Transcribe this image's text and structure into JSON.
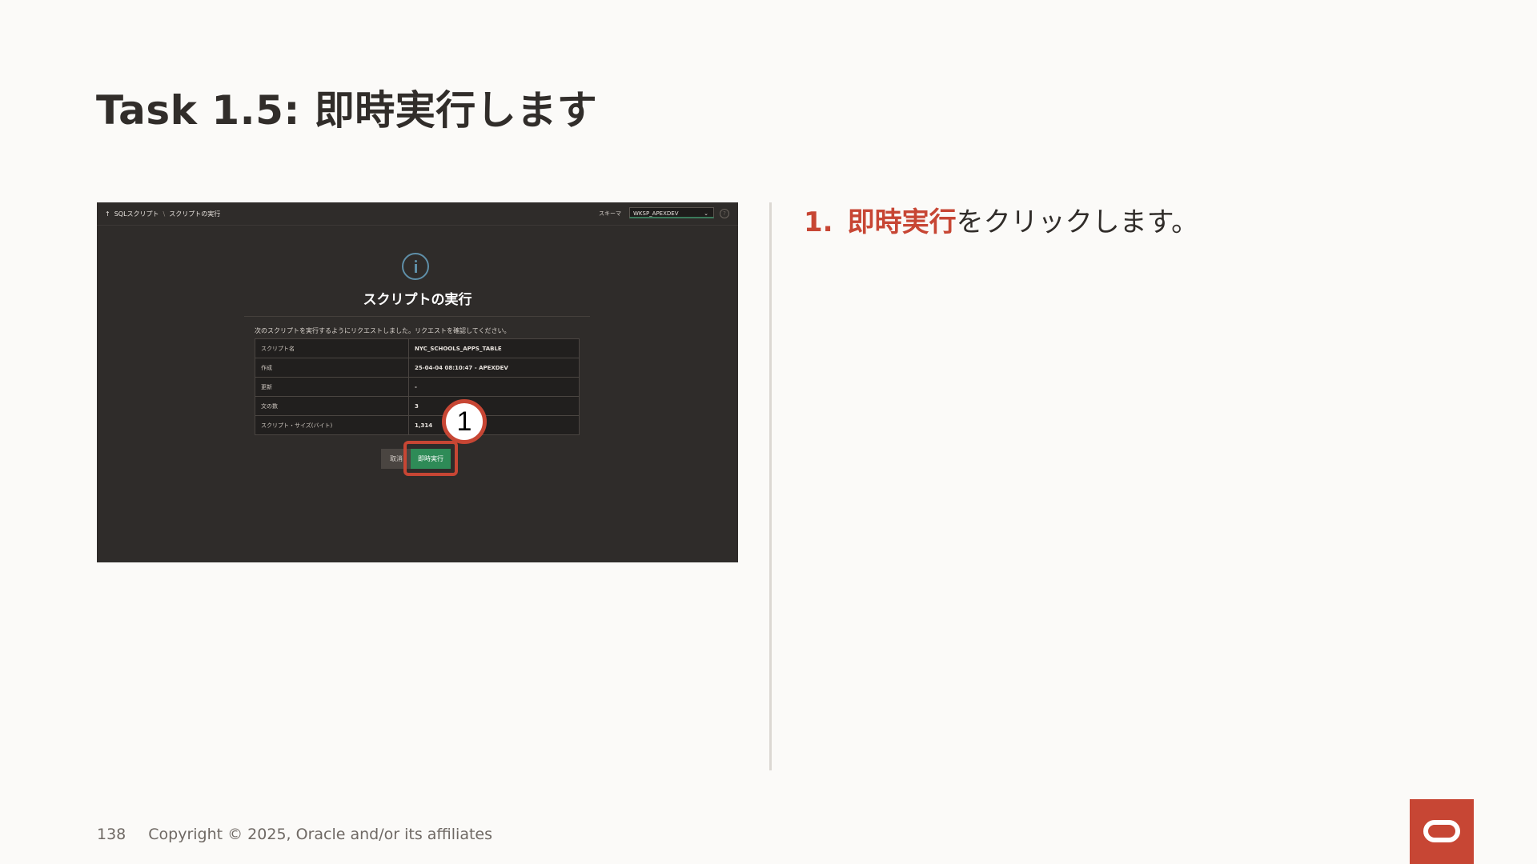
{
  "slide": {
    "title": "Task 1.5: 即時実行します",
    "page_number": "138",
    "copyright": "Copyright © 2025, Oracle and/or its affiliates"
  },
  "instruction": {
    "number": "1.",
    "highlight": "即時実行",
    "text": "をクリックします。"
  },
  "screenshot": {
    "breadcrumb": {
      "up_icon": "↑",
      "parent": "SQLスクリプト",
      "separator": "\\",
      "current": "スクリプトの実行"
    },
    "schema_label": "スキーマ",
    "schema_value": "WKSP_APEXDEV",
    "dialog_title": "スクリプトの実行",
    "message": "次のスクリプトを実行するようにリクエストしました。リクエストを確認してください。",
    "properties": [
      {
        "label": "スクリプト名",
        "value": "NYC_SCHOOLS_APPS_TABLE"
      },
      {
        "label": "作成",
        "value": "25-04-04 08:10:47 - APEXDEV"
      },
      {
        "label": "更新",
        "value": "-"
      },
      {
        "label": "文の数",
        "value": "3"
      },
      {
        "label": "スクリプト・サイズ(バイト)",
        "value": "1,314"
      }
    ],
    "cancel_label": "取消",
    "run_now_label": "即時実行",
    "callout_number": "1"
  },
  "colors": {
    "accent_red": "#c74634",
    "run_button_green": "#2e8b57",
    "panel_bg": "#2f2c2a"
  }
}
